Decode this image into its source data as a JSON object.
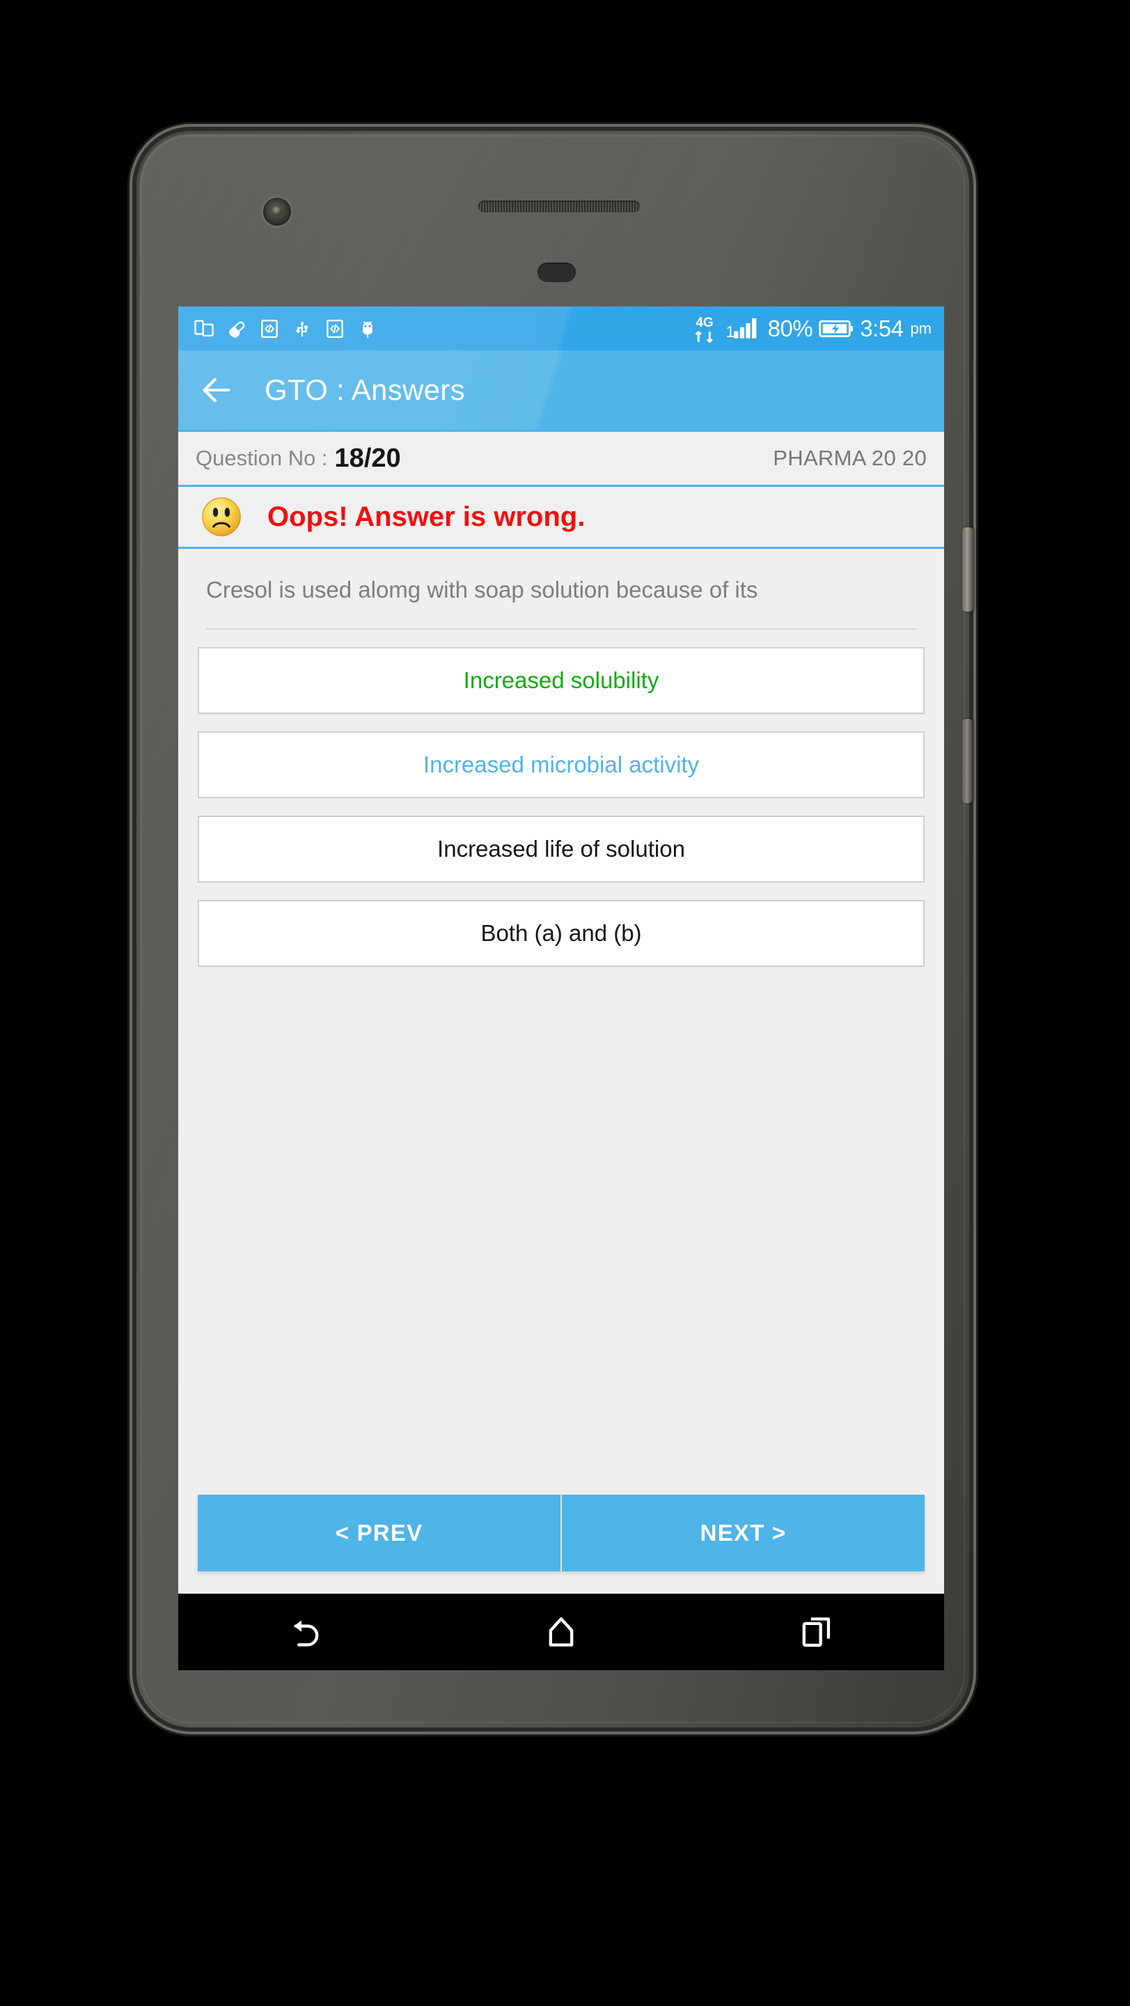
{
  "status_bar": {
    "left_icons": [
      {
        "name": "multi-window-icon"
      },
      {
        "name": "capsule-pill-icon"
      },
      {
        "name": "code-developer-icon"
      },
      {
        "name": "usb-icon"
      },
      {
        "name": "code-developer-icon-2"
      },
      {
        "name": "android-bug-icon"
      }
    ],
    "network_type": "4G",
    "signal_label": "1",
    "battery_percent": "80%",
    "time": "3:54",
    "am_pm": "pm",
    "background_color": "#30a5e8"
  },
  "app_bar": {
    "back_icon": "back-arrow-icon",
    "title": "GTO : Answers",
    "background_color": "#4fb4e8"
  },
  "question_bar": {
    "label": "Question No :",
    "value": "18/20",
    "exam_name": "PHARMA 20 20"
  },
  "result_bar": {
    "emoji": "sad-face-emoji",
    "message": "Oops! Answer is wrong.",
    "message_color": "#f40e0e"
  },
  "question": {
    "text": "Cresol is used alomg with soap solution because of its"
  },
  "options": [
    {
      "label": "Increased solubility",
      "color": "#14aa14",
      "state": "correct"
    },
    {
      "label": "Increased microbial activity",
      "color": "#4fb4e8",
      "state": "selected-wrong"
    },
    {
      "label": "Increased life of solution",
      "color": "#161616",
      "state": "neutral"
    },
    {
      "label": "Both (a) and (b)",
      "color": "#161616",
      "state": "neutral"
    }
  ],
  "navigation": {
    "prev_label": "< PREV",
    "next_label": "NEXT >"
  },
  "android_nav": {
    "back": "back-nav-icon",
    "home": "home-nav-icon",
    "recents": "recents-nav-icon"
  }
}
